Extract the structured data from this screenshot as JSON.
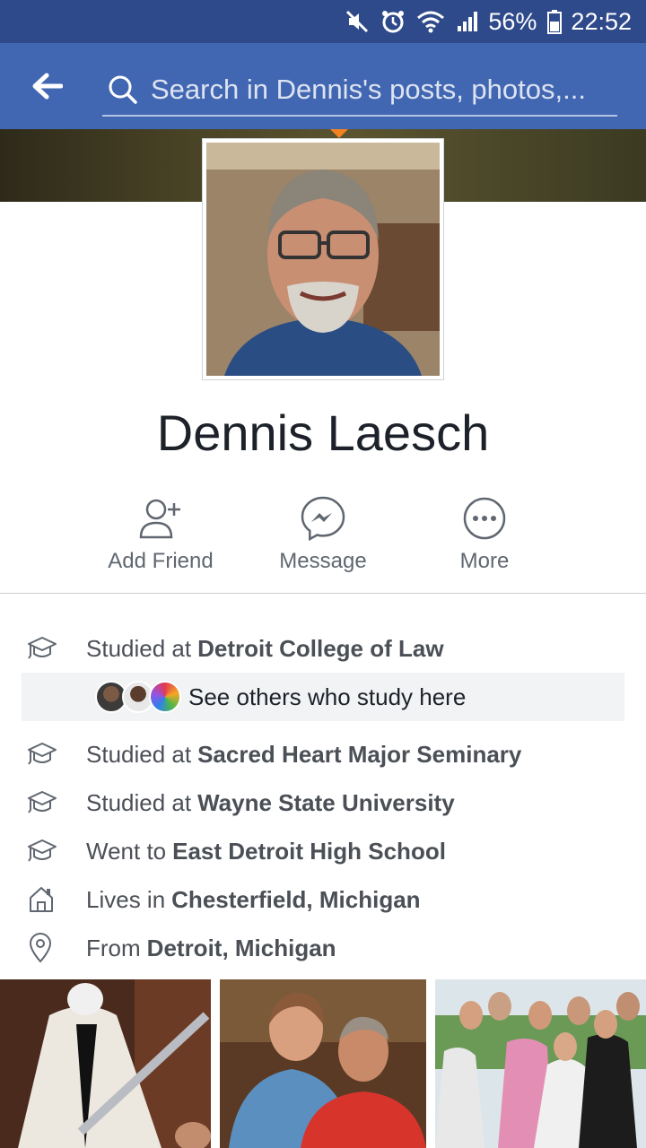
{
  "status_bar": {
    "battery": "56%",
    "time": "22:52"
  },
  "header": {
    "search_placeholder": "Search in Dennis's posts, photos,..."
  },
  "profile": {
    "name": "Dennis Laesch"
  },
  "actions": [
    {
      "label": "Add Friend",
      "icon": "add-friend-icon"
    },
    {
      "label": "Message",
      "icon": "messenger-icon"
    },
    {
      "label": "More",
      "icon": "more-icon"
    }
  ],
  "intro": {
    "items": [
      {
        "prefix": "Studied at",
        "value": "Detroit College of Law",
        "icon": "graduation-cap-icon"
      },
      {
        "prefix": "Studied at",
        "value": "Sacred Heart Major Seminary",
        "icon": "graduation-cap-icon"
      },
      {
        "prefix": "Studied at",
        "value": "Wayne State University",
        "icon": "graduation-cap-icon"
      },
      {
        "prefix": "Went to",
        "value": "East Detroit High School",
        "icon": "graduation-cap-icon"
      },
      {
        "prefix": "Lives in",
        "value": "Chesterfield, Michigan",
        "icon": "home-icon"
      },
      {
        "prefix": "From",
        "value": "Detroit, Michigan",
        "icon": "location-pin-icon"
      }
    ],
    "see_others": "See others who study here"
  },
  "colors": {
    "brand": "#4267b2",
    "status_bar": "#2e4a8a",
    "text_secondary": "#606770"
  }
}
